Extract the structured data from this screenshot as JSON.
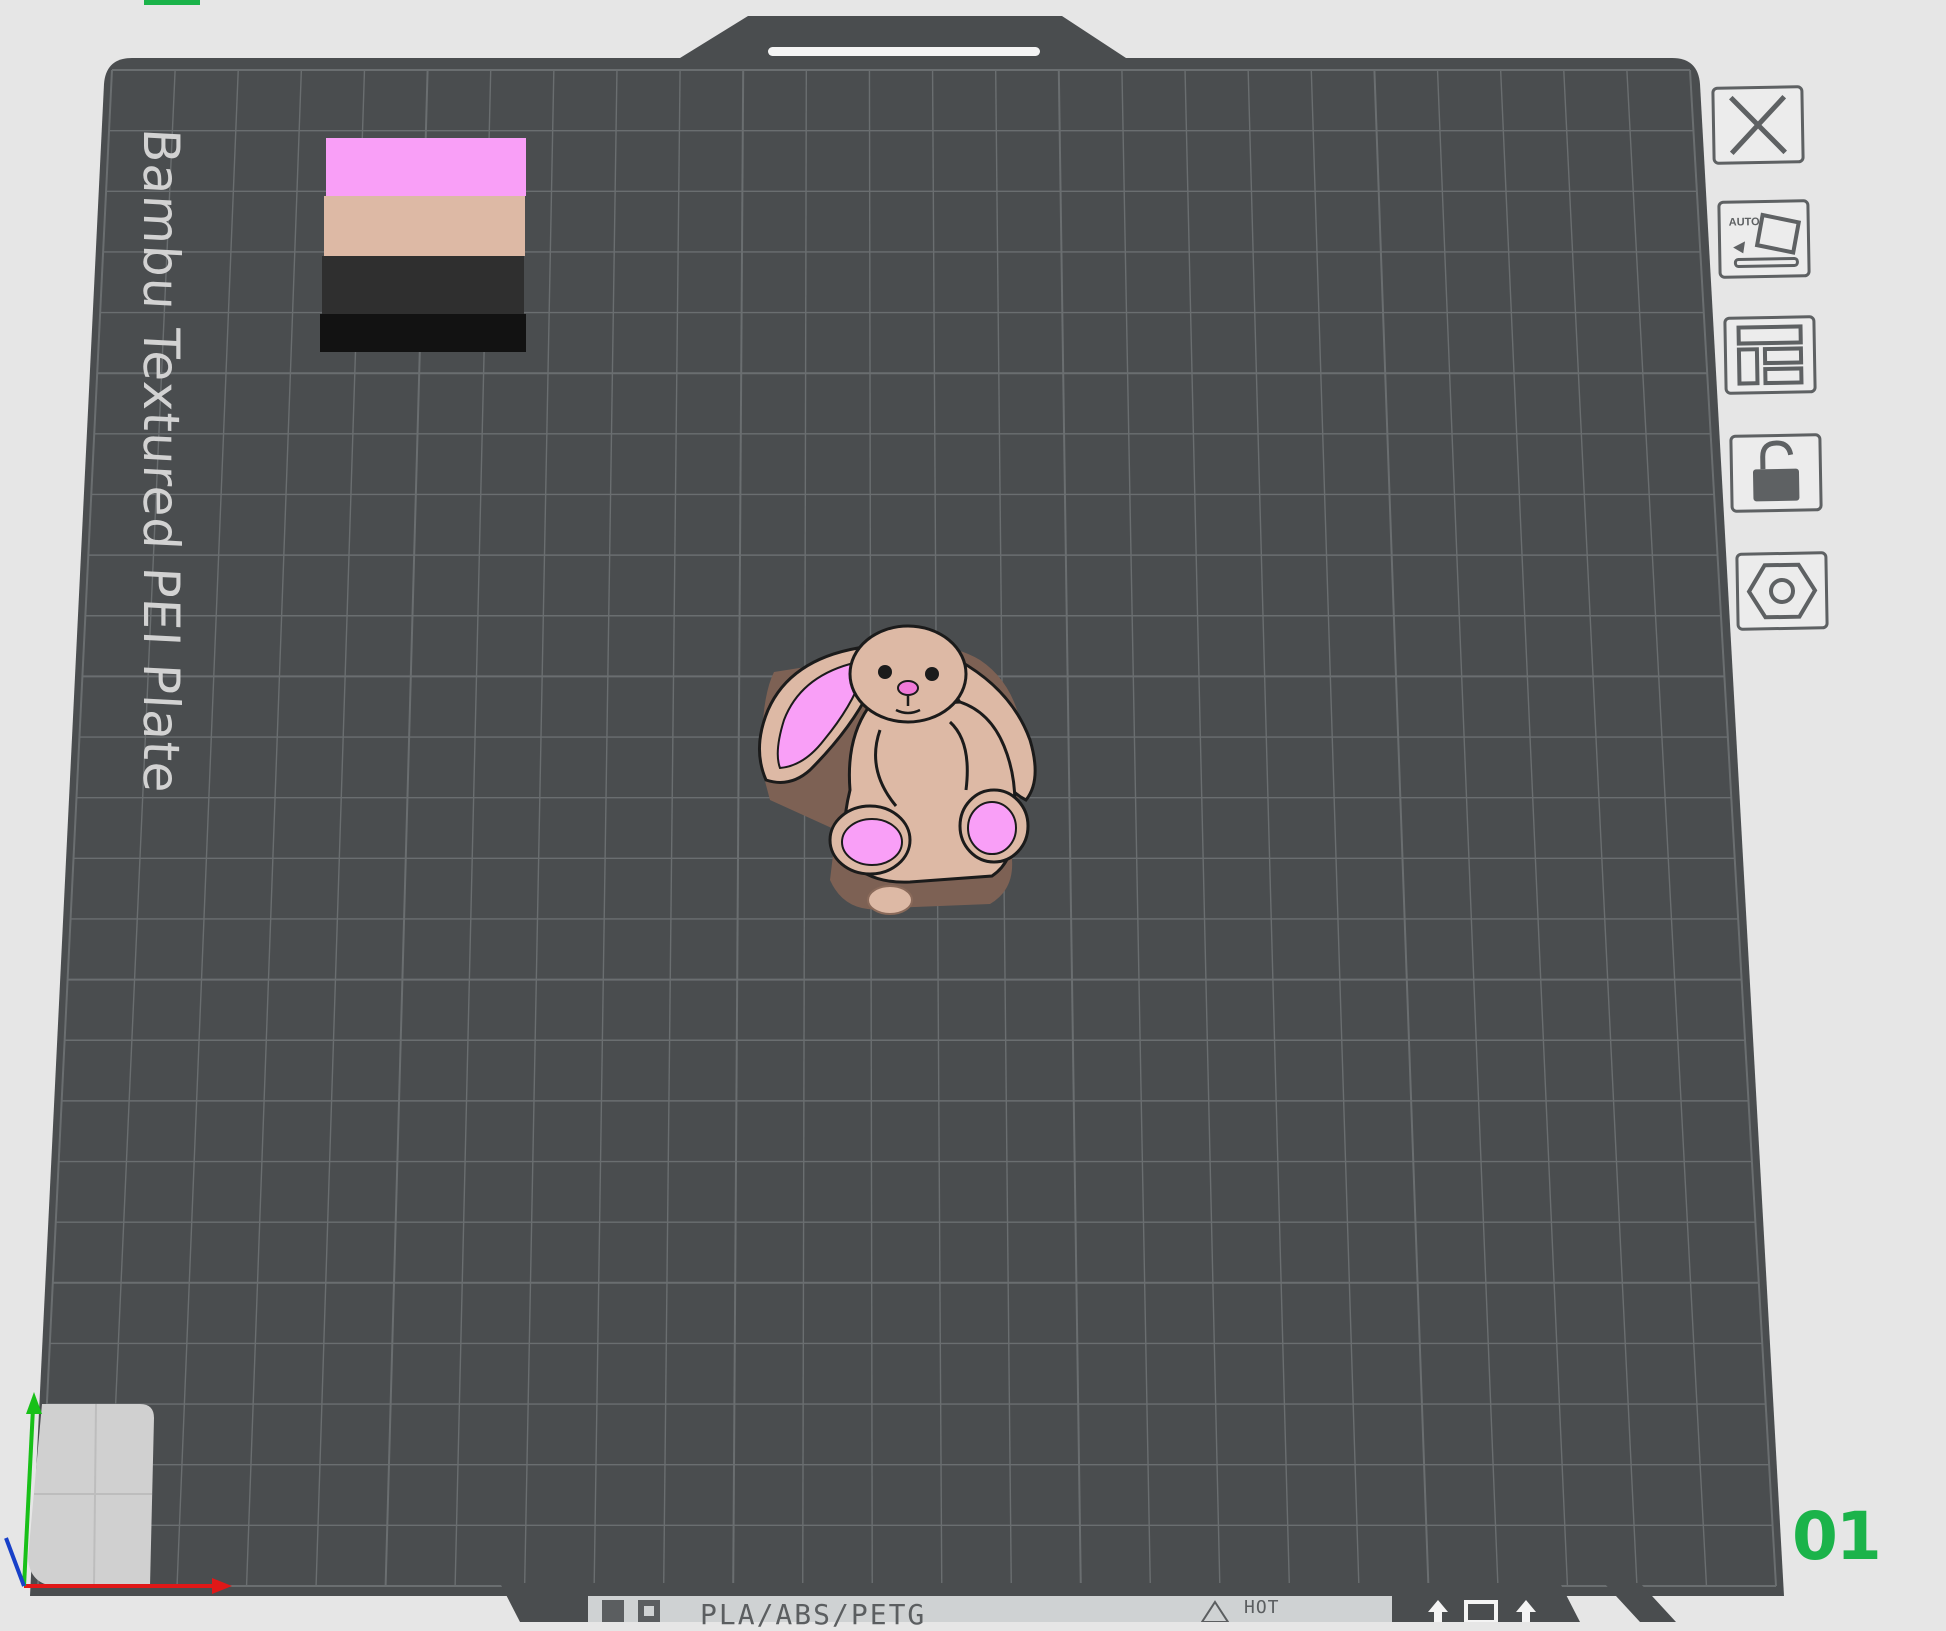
{
  "plate": {
    "label": "Bambu Textured PEI Plate",
    "number": "01",
    "bottom_text": "PLA/ABS/PETG",
    "bottom_hot": "HOT",
    "grid_divisions": 25
  },
  "toolbar": {
    "buttons": [
      {
        "name": "delete-plate-button",
        "icon": "close-icon"
      },
      {
        "name": "auto-orient-button",
        "icon": "auto-orient-icon",
        "text": "AUTO"
      },
      {
        "name": "arrange-button",
        "icon": "arrange-icon"
      },
      {
        "name": "lock-plate-button",
        "icon": "unlock-icon"
      },
      {
        "name": "plate-settings-button",
        "icon": "hex-nut-settings-icon"
      }
    ]
  },
  "colors": {
    "background": "#e6e6e6",
    "plate": "#4a4d4f",
    "grid": "#6a6e70",
    "filament_pink": "#f99ff7",
    "filament_beige": "#ddb9a5",
    "filament_black": "#2b2b2b",
    "axis_x": "#e01818",
    "axis_y": "#18c018",
    "axis_z": "#1840c8",
    "accent": "#1bb34a"
  }
}
